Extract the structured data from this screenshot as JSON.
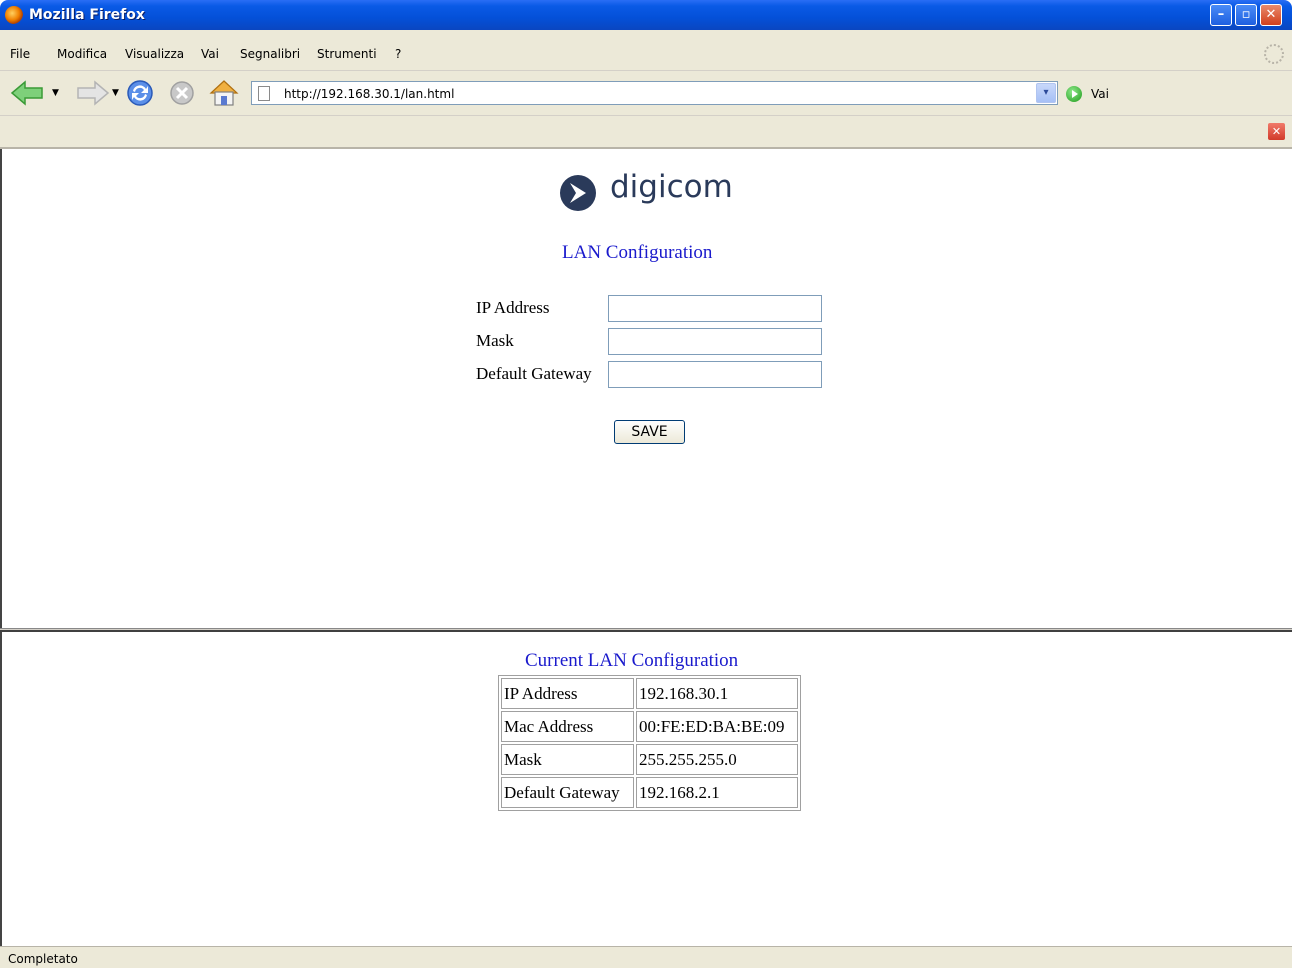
{
  "window": {
    "title": "Mozilla Firefox",
    "minimize_glyph": "–",
    "maximize_glyph": "▫",
    "close_glyph": "✕"
  },
  "menu": {
    "items": [
      "File",
      "Modifica",
      "Visualizza",
      "Vai",
      "Segnalibri",
      "Strumenti",
      "?"
    ]
  },
  "navigation": {
    "url": "http://192.168.30.1/lan.html",
    "go_label": "Vai",
    "dropdown_glyph": "▾",
    "back_dropdown_glyph": "▼",
    "forward_dropdown_glyph": "▼"
  },
  "findbar": {
    "close_glyph": "✕"
  },
  "brand": {
    "logo_text": "digicom"
  },
  "lan_form": {
    "heading": "LAN Configuration",
    "fields": [
      {
        "label": "IP Address",
        "value": ""
      },
      {
        "label": "Mask",
        "value": ""
      },
      {
        "label": "Default Gateway",
        "value": ""
      }
    ],
    "save_label": "SAVE"
  },
  "current_config": {
    "heading": "Current LAN Configuration",
    "rows": [
      {
        "key": "IP Address",
        "value": "192.168.30.1"
      },
      {
        "key": "Mac Address",
        "value": "00:FE:ED:BA:BE:09"
      },
      {
        "key": "Mask",
        "value": "255.255.255.0"
      },
      {
        "key": "Default Gateway",
        "value": "192.168.2.1"
      }
    ]
  },
  "status": {
    "text": "Completato"
  },
  "colors": {
    "heading": "#1a1acc",
    "titlebar": "#0450d8",
    "chrome": "#ece9d8",
    "logo_text": "#2a3a5a"
  }
}
